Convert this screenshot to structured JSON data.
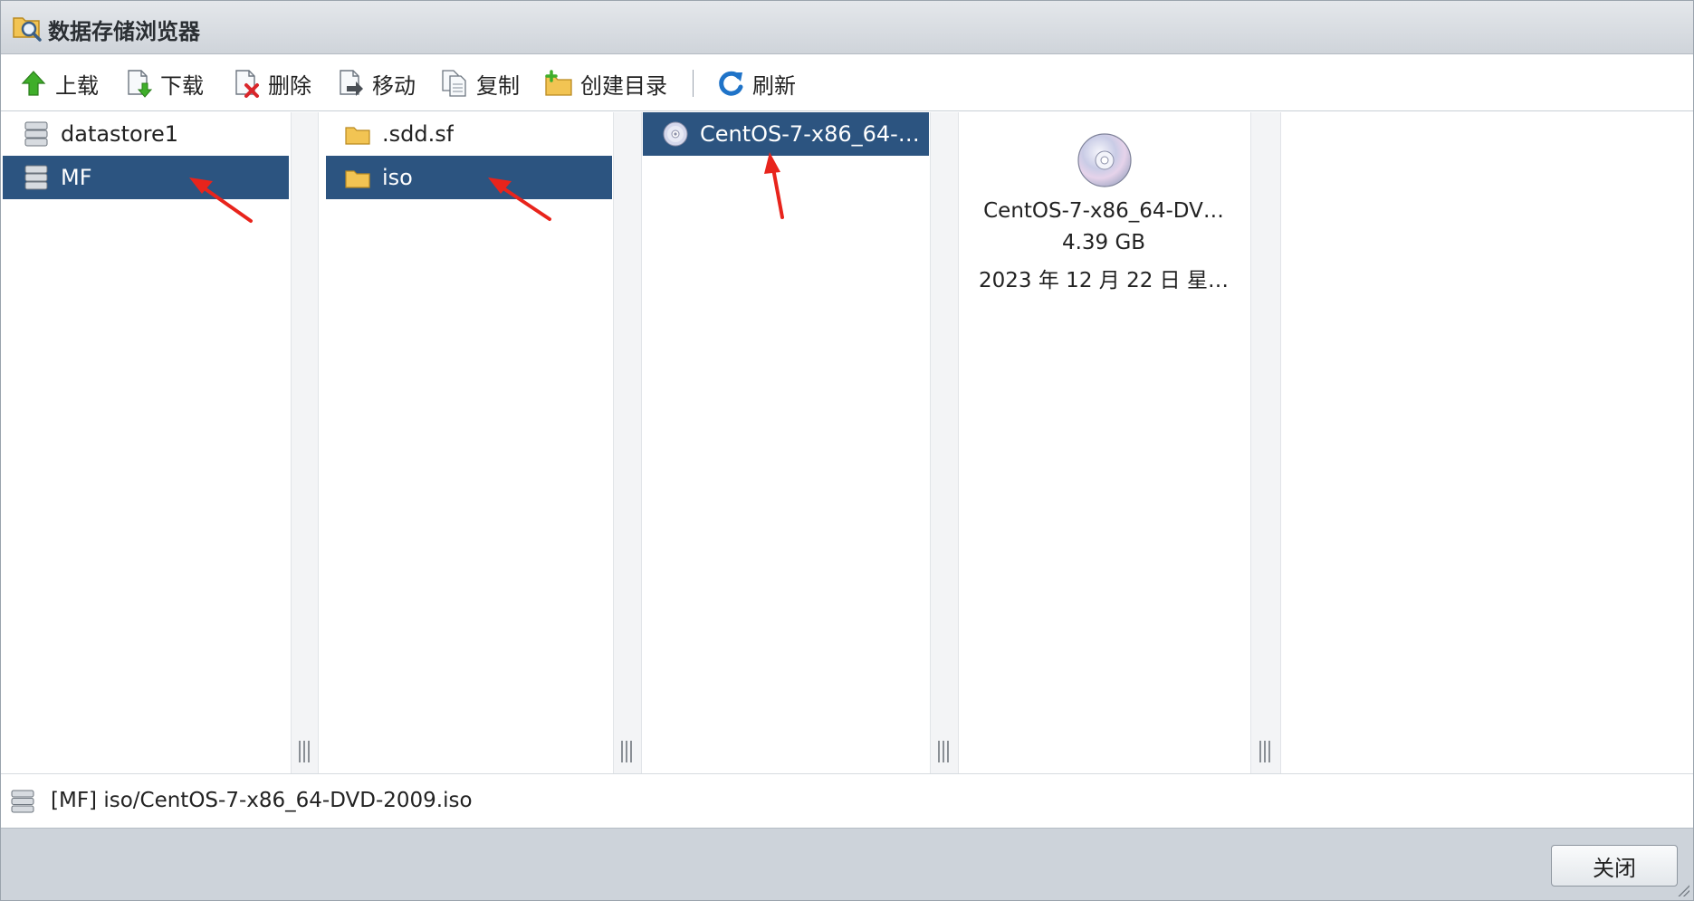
{
  "window": {
    "title": "数据存储浏览器"
  },
  "toolbar": {
    "upload": "上载",
    "download": "下载",
    "delete": "删除",
    "move": "移动",
    "copy": "复制",
    "create_dir": "创建目录",
    "refresh": "刷新"
  },
  "columns": {
    "datastores": [
      {
        "label": "datastore1",
        "icon": "datastore-icon",
        "selected": false
      },
      {
        "label": "MF",
        "icon": "datastore-icon",
        "selected": true
      }
    ],
    "folders": [
      {
        "label": ".sdd.sf",
        "icon": "folder-icon",
        "selected": false
      },
      {
        "label": "iso",
        "icon": "folder-icon",
        "selected": true
      }
    ],
    "files": [
      {
        "label": "CentOS-7-x86_64-…",
        "icon": "disc-icon",
        "selected": true
      }
    ]
  },
  "preview": {
    "name": "CentOS-7-x86_64-DV…",
    "size": "4.39 GB",
    "date": "2023 年 12 月 22 日 星…"
  },
  "pathbar": {
    "path": "[MF] iso/CentOS-7-x86_64-DVD-2009.iso"
  },
  "footer": {
    "close": "关闭"
  },
  "colors": {
    "selection": "#2c5480",
    "annotation_arrow": "#e8241c"
  }
}
